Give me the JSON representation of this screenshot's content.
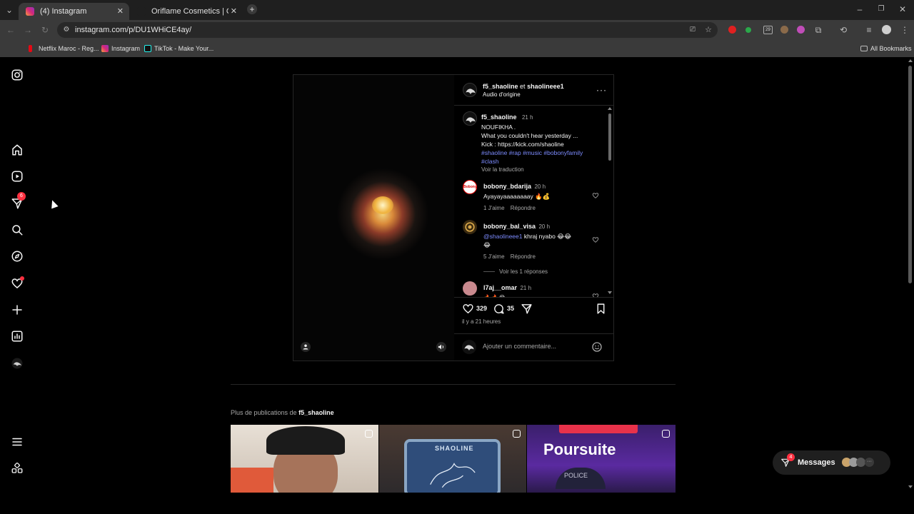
{
  "browser": {
    "tabs": [
      {
        "title": "(4) Instagram",
        "active": true
      },
      {
        "title": "Oriflame Cosmetics | Oriflame C",
        "active": false
      }
    ],
    "url": "instagram.com/p/DU1WHiCE4ay/",
    "bookmarks": [
      "Netflix Maroc - Reg...",
      "Instagram",
      "TikTok - Make Your..."
    ],
    "all_bookmarks": "All Bookmarks",
    "ext_badge": "29"
  },
  "nav": {
    "notification_badge": "6"
  },
  "post": {
    "header_user1": "f5_shaoline",
    "header_joiner": "et",
    "header_user2": "shaolineee1",
    "audio": "Audio d'origine",
    "caption": {
      "username": "f5_shaoline",
      "time": "21 h",
      "lines": [
        "NOUFIKHA .",
        "What you couldn't hear yesterday ...",
        "Kick : https://kick.com/shaoline"
      ],
      "hashtags1": "#shaoline #rap #music #bobonyfamily",
      "hashtags2": "#clash",
      "translate": "Voir la traduction"
    },
    "comments": [
      {
        "username": "bobony_bdarija",
        "time": "20 h",
        "text": "Ayayayaaaaaaaay 🔥💰",
        "likes": "1 J'aime",
        "reply": "Répondre"
      },
      {
        "username": "bobony_bal_visa",
        "time": "20 h",
        "mention": "@shaolineee1",
        "text": " khraj nyabo 😂😂",
        "text2": "😂",
        "likes": "5 J'aime",
        "reply": "Répondre",
        "view_replies": "Voir les 1 réponses"
      },
      {
        "username": "l7aj__omar",
        "time": "21 h",
        "text": "🔥🔥😂"
      }
    ],
    "like_count": "329",
    "comment_count": "35",
    "posted": "il y a 21 heures",
    "add_comment_placeholder": "Ajouter un commentaire..."
  },
  "more": {
    "prefix": "Plus de publications de",
    "username": "f5_shaoline",
    "thumb2_text": "SHAOLINE",
    "thumb3_title": "Poursuite",
    "thumb3_sub": "POLICE"
  },
  "messages": {
    "label": "Messages",
    "badge": "4"
  },
  "colors": {
    "background": "#000000",
    "hashtag": "#7d8cff",
    "badge_red": "#ff3040"
  }
}
